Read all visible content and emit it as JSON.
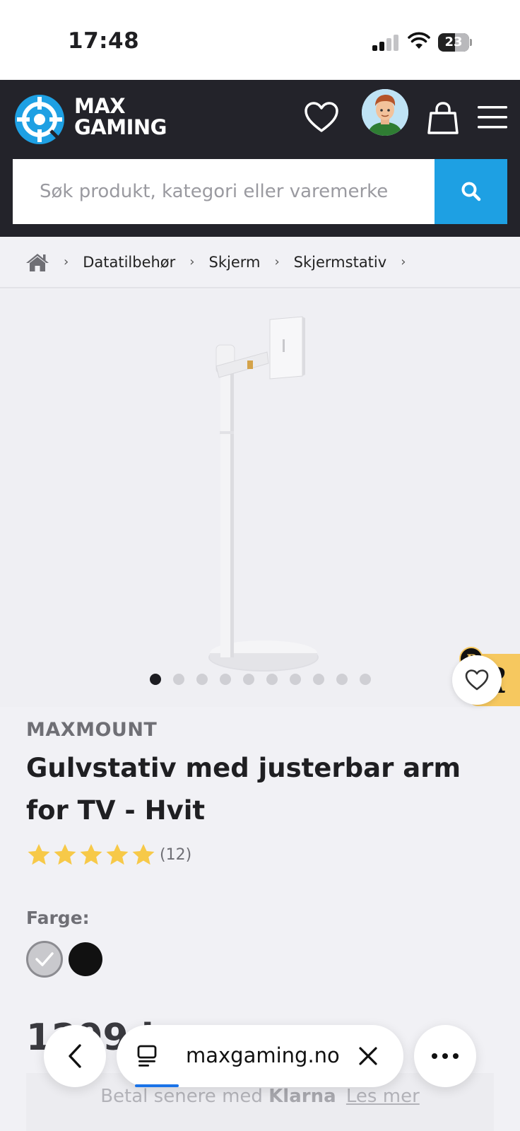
{
  "status_bar": {
    "time": "17:48",
    "battery": "23"
  },
  "header": {
    "logo_line1": "MAX",
    "logo_line2": "GAMING",
    "search_placeholder": "Søk produkt, kategori eller varemerke"
  },
  "breadcrumb": {
    "items": [
      "Datatilbehør",
      "Skjerm",
      "Skjermstativ"
    ]
  },
  "gallery": {
    "image_count": 10,
    "active_index": 0
  },
  "product": {
    "brand": "MAXMOUNT",
    "title": "Gulvstativ med justerbar arm for TV - Hvit",
    "rating": 5,
    "review_count": "(12)",
    "color_label": "Farge:",
    "colors": [
      {
        "name": "white",
        "hex": "#c9c9cd",
        "selected": true
      },
      {
        "name": "black",
        "hex": "#111111",
        "selected": false
      }
    ],
    "price_partial": "1299 kr"
  },
  "klarna": {
    "prefix": "Betal senere med",
    "brand": "Klarna",
    "link": "Les mer"
  },
  "browser": {
    "url": "maxgaming.no"
  },
  "colors": {
    "header_bg": "#23232a",
    "accent_blue": "#1ea0e3",
    "star_yellow": "#f7c948",
    "badge_yellow": "#f6c85f"
  }
}
